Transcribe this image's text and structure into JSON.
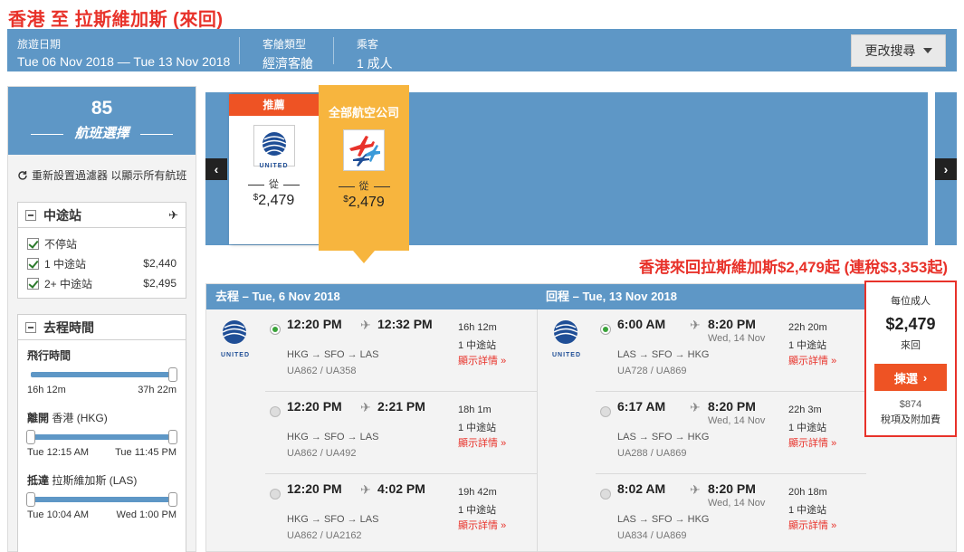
{
  "page_title": "香港 至 拉斯維加斯 (來回)",
  "search_bar": {
    "dates_label": "旅遊日期",
    "dates_value": "Tue 06 Nov 2018 — Tue 13 Nov 2018",
    "cabin_label": "客艙類型",
    "cabin_value": "經濟客艙",
    "pax_label": "乘客",
    "pax_value": "1 成人",
    "change_label": "更改搜尋"
  },
  "sidebar": {
    "count": "85",
    "count_label": "航班選擇",
    "reset_label": "重新設置過濾器 以顯示所有航班",
    "stops": {
      "title": "中途站",
      "options": [
        {
          "label": "不停站",
          "price": ""
        },
        {
          "label": "1 中途站",
          "price": "$2,440"
        },
        {
          "label": "2+ 中途站",
          "price": "$2,495"
        }
      ]
    },
    "outbound_time": {
      "title": "去程時間",
      "duration_title": "飛行時間",
      "duration_min": "16h 12m",
      "duration_max": "37h 22m",
      "depart_title": "離開",
      "depart_place": "香港 (HKG)",
      "depart_min": "Tue 12:15 AM",
      "depart_max": "Tue 11:45 PM",
      "arrive_title": "抵達",
      "arrive_place": "拉斯維加斯 (LAS)",
      "arrive_min": "Tue 10:04 AM",
      "arrive_max": "Wed 1:00 PM"
    }
  },
  "carousel": {
    "recommended_tag": "推薦",
    "all_airlines_tag": "全部航空公司",
    "from_label": "從",
    "rec_price": "2,479",
    "all_price": "2,479",
    "currency": "$",
    "logo_text": "UNITED"
  },
  "promo_text": "香港來回拉斯維加斯$2,479起 (連稅$3,353起)",
  "outbound": {
    "header": "去程 – Tue, 6 Nov 2018",
    "flights": [
      {
        "dep": "12:20 PM",
        "arr": "12:32 PM",
        "next_day": "",
        "route": "HKG → SFO → LAS",
        "flight_no": "UA862 / UA358",
        "duration": "16h 12m",
        "stops": "1 中途站",
        "detail": "顯示詳情",
        "selected": true
      },
      {
        "dep": "12:20 PM",
        "arr": "2:21 PM",
        "next_day": "",
        "route": "HKG → SFO → LAS",
        "flight_no": "UA862 / UA492",
        "duration": "18h 1m",
        "stops": "1 中途站",
        "detail": "顯示詳情",
        "selected": false
      },
      {
        "dep": "12:20 PM",
        "arr": "4:02 PM",
        "next_day": "",
        "route": "HKG → SFO → LAS",
        "flight_no": "UA862 / UA2162",
        "duration": "19h 42m",
        "stops": "1 中途站",
        "detail": "顯示詳情",
        "selected": false
      }
    ]
  },
  "inbound": {
    "header": "回程 – Tue, 13 Nov 2018",
    "flights": [
      {
        "dep": "6:00 AM",
        "arr": "8:20 PM",
        "next_day": "Wed, 14 Nov",
        "route": "LAS → SFO → HKG",
        "flight_no": "UA728 / UA869",
        "duration": "22h 20m",
        "stops": "1 中途站",
        "detail": "顯示詳情",
        "selected": true
      },
      {
        "dep": "6:17 AM",
        "arr": "8:20 PM",
        "next_day": "Wed, 14 Nov",
        "route": "LAS → SFO → HKG",
        "flight_no": "UA288 / UA869",
        "duration": "22h 3m",
        "stops": "1 中途站",
        "detail": "顯示詳情",
        "selected": false
      },
      {
        "dep": "8:02 AM",
        "arr": "8:20 PM",
        "next_day": "Wed, 14 Nov",
        "route": "LAS → SFO → HKG",
        "flight_no": "UA834 / UA869",
        "duration": "20h 18m",
        "stops": "1 中途站",
        "detail": "顯示詳情",
        "selected": false
      }
    ]
  },
  "price_panel": {
    "per_adult": "每位成人",
    "price": "$2,479",
    "round_trip": "來回",
    "select_label": "揀選",
    "tax": "$874",
    "tax_label": "稅項及附加費"
  },
  "colors": {
    "brand_blue": "#5e97c6",
    "accent_red": "#e8322a",
    "button_orange": "#ee5324",
    "highlight_yellow": "#f7b53e"
  }
}
